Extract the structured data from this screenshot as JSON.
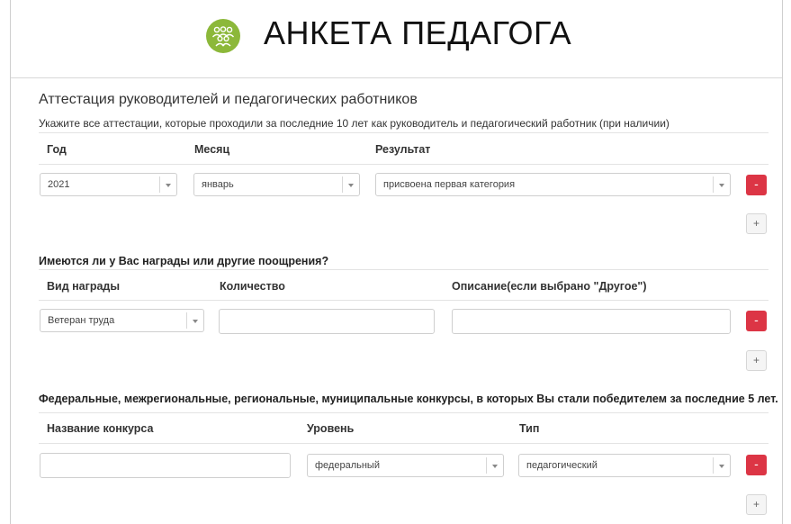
{
  "header": {
    "title": "АНКЕТА ПЕДАГОГА"
  },
  "attestation": {
    "section_title": "Аттестация руководителей и педагогических работников",
    "hint": "Укажите все аттестации, которые проходили за последние 10 лет как руководитель и педагогический работник (при наличии)",
    "columns": {
      "year": "Год",
      "month": "Месяц",
      "result": "Результат"
    },
    "row": {
      "year": "2021",
      "month": "январь",
      "result": "присвоена первая категория"
    }
  },
  "awards": {
    "title": "Имеются ли у Вас награды или другие поощрения?",
    "columns": {
      "type": "Вид награды",
      "count": "Количество",
      "description": "Описание(если выбрано \"Другое\")"
    },
    "row": {
      "type": "Ветеран труда",
      "count": "",
      "description": ""
    }
  },
  "contests": {
    "title": "Федеральные, межрегиональные, региональные, муниципальные конкурсы, в которых Вы стали победителем за последние 5 лет.",
    "columns": {
      "name": "Название конкурса",
      "level": "Уровень",
      "type": "Тип"
    },
    "row": {
      "name": "",
      "level": "федеральный",
      "type": "педагогический"
    }
  },
  "buttons": {
    "remove": "-",
    "add": "+"
  },
  "icons": {
    "logo": "people-group-icon",
    "dropdown": "chevron-down-icon"
  },
  "colors": {
    "logo_green": "#8cb83a",
    "remove_red": "#dc3545"
  }
}
